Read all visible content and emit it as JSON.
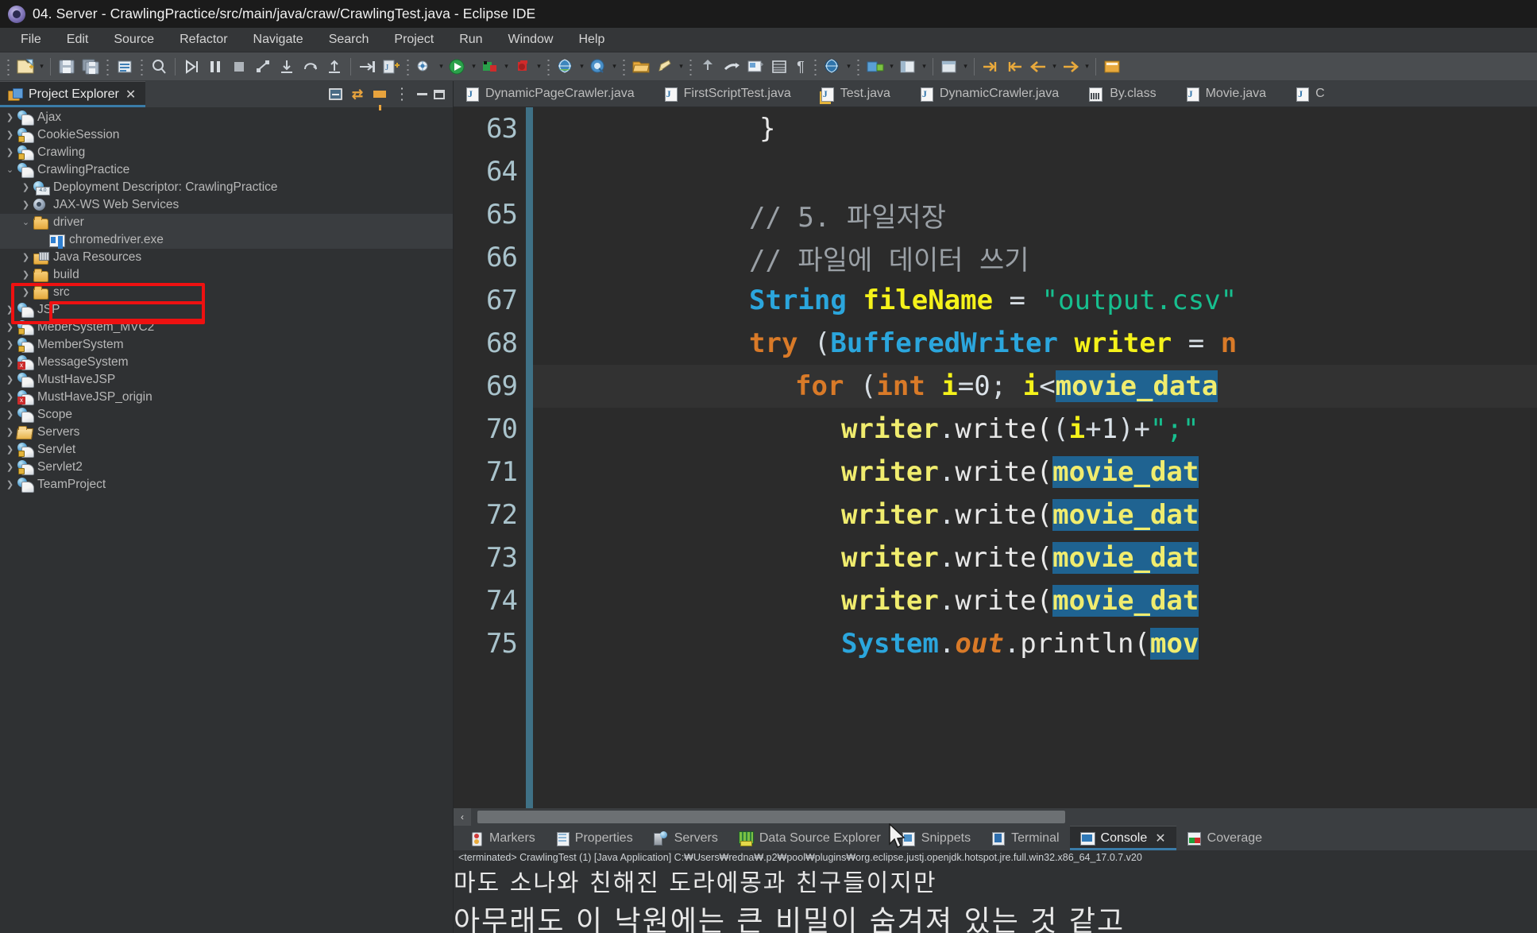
{
  "window": {
    "title": "04. Server - CrawlingPractice/src/main/java/craw/CrawlingTest.java - Eclipse IDE",
    "logo_icon": "eclipse-logo-icon"
  },
  "menubar": {
    "items": [
      "File",
      "Edit",
      "Source",
      "Refactor",
      "Navigate",
      "Search",
      "Project",
      "Run",
      "Window",
      "Help"
    ]
  },
  "toolbar": {
    "icon_names": [
      "new-wizard-icon",
      "save-icon",
      "save-all-icon",
      "print-icon",
      "quick-access-search-icon",
      "run-step-icon",
      "pause-icon",
      "terminate-icon",
      "disconnect-icon",
      "step-into-icon",
      "step-over-icon",
      "step-return-icon",
      "open-type-icon",
      "new-java-class-icon",
      "external-tools-icon",
      "run-icon",
      "debug-icon",
      "coverage-icon",
      "new-server-icon",
      "search-icon",
      "open-folder-icon",
      "edit-icon",
      "git-push-icon",
      "git-pull-icon",
      "image-icon",
      "table-icon",
      "pilcrow-icon",
      "web-browser-icon",
      "profile-icon",
      "perspective-icon",
      "layout-icon",
      "next-annotation-icon",
      "previous-annotation-icon",
      "back-icon",
      "forward-icon",
      "terminal-open-icon"
    ]
  },
  "project_explorer": {
    "tab_label": "Project Explorer",
    "tab_icon": "project-explorer-icon",
    "close_icon": "close-icon",
    "toolbar_icons": [
      "collapse-all-icon",
      "link-with-editor-icon",
      "view-menu-filter-icon",
      "view-menu-icon",
      "minimize-icon",
      "maximize-icon"
    ],
    "tree": [
      {
        "label": "Ajax",
        "indent": 0,
        "twist": "collapsed",
        "icon": "dynamic-web-project-icon"
      },
      {
        "label": "CookieSession",
        "indent": 0,
        "twist": "collapsed",
        "icon": "dynamic-web-project-locked-icon"
      },
      {
        "label": "Crawling",
        "indent": 0,
        "twist": "collapsed",
        "icon": "dynamic-web-project-locked-icon"
      },
      {
        "label": "CrawlingPractice",
        "indent": 0,
        "twist": "expanded",
        "icon": "dynamic-web-project-icon"
      },
      {
        "label": "Deployment Descriptor: CrawlingPractice",
        "indent": 1,
        "twist": "collapsed",
        "icon": "deployment-descriptor-icon"
      },
      {
        "label": "JAX-WS Web Services",
        "indent": 1,
        "twist": "collapsed",
        "icon": "jax-ws-icon"
      },
      {
        "label": "driver",
        "indent": 1,
        "twist": "expanded",
        "icon": "folder-icon",
        "selected": true
      },
      {
        "label": "chromedriver.exe",
        "indent": 2,
        "twist": "none",
        "icon": "executable-file-icon",
        "selected": true
      },
      {
        "label": "Java Resources",
        "indent": 1,
        "twist": "collapsed",
        "icon": "java-resources-icon"
      },
      {
        "label": "build",
        "indent": 1,
        "twist": "collapsed",
        "icon": "folder-icon"
      },
      {
        "label": "src",
        "indent": 1,
        "twist": "collapsed",
        "icon": "folder-icon"
      },
      {
        "label": "JSP",
        "indent": 0,
        "twist": "collapsed",
        "icon": "dynamic-web-project-icon"
      },
      {
        "label": "MeberSystem_MVC2",
        "indent": 0,
        "twist": "collapsed",
        "icon": "dynamic-web-project-locked-icon"
      },
      {
        "label": "MemberSystem",
        "indent": 0,
        "twist": "collapsed",
        "icon": "dynamic-web-project-locked-icon"
      },
      {
        "label": "MessageSystem",
        "indent": 0,
        "twist": "collapsed",
        "icon": "dynamic-web-project-error-icon"
      },
      {
        "label": "MustHaveJSP",
        "indent": 0,
        "twist": "collapsed",
        "icon": "dynamic-web-project-icon"
      },
      {
        "label": "MustHaveJSP_origin",
        "indent": 0,
        "twist": "collapsed",
        "icon": "dynamic-web-project-error-icon"
      },
      {
        "label": "Scope",
        "indent": 0,
        "twist": "collapsed",
        "icon": "dynamic-web-project-icon"
      },
      {
        "label": "Servers",
        "indent": 0,
        "twist": "collapsed",
        "icon": "servers-folder-icon"
      },
      {
        "label": "Servlet",
        "indent": 0,
        "twist": "collapsed",
        "icon": "dynamic-web-project-locked-icon"
      },
      {
        "label": "Servlet2",
        "indent": 0,
        "twist": "collapsed",
        "icon": "dynamic-web-project-locked-icon"
      },
      {
        "label": "TeamProject",
        "indent": 0,
        "twist": "collapsed",
        "icon": "dynamic-web-project-icon"
      }
    ],
    "annotation_color": "#ee1111"
  },
  "editor": {
    "tabs": [
      {
        "label": "DynamicPageCrawler.java",
        "icon": "java-file-icon"
      },
      {
        "label": "FirstScriptTest.java",
        "icon": "java-file-icon"
      },
      {
        "label": "Test.java",
        "icon": "java-file-warning-icon"
      },
      {
        "label": "DynamicCrawler.java",
        "icon": "java-file-icon"
      },
      {
        "label": "By.class",
        "icon": "class-file-icon"
      },
      {
        "label": "Movie.java",
        "icon": "java-file-icon"
      },
      {
        "label": "C",
        "icon": "java-file-icon"
      }
    ],
    "line_numbers": [
      "63",
      "64",
      "65",
      "66",
      "67",
      "68",
      "69",
      "70",
      "71",
      "72",
      "73",
      "74",
      "75"
    ],
    "current_line": "69",
    "scrollbar": {
      "left_arrow_icon": "chevron-left-icon"
    },
    "lines": [
      {
        "num": "63",
        "text": "\t\t}"
      },
      {
        "num": "64",
        "text": ""
      },
      {
        "num": "65",
        "text": "\t\t// 5. 파일저장"
      },
      {
        "num": "66",
        "text": "\t\t// 파일에 데이터 쓰기"
      },
      {
        "num": "67",
        "text": "\t\tString fileName = \"output.csv\""
      },
      {
        "num": "68",
        "text": "\t\ttry (BufferedWriter writer = n"
      },
      {
        "num": "69",
        "text": "\t\t\tfor (int i=0; i<movie_data"
      },
      {
        "num": "70",
        "text": "\t\t\t\twriter.write((i+1)+\";\""
      },
      {
        "num": "71",
        "text": "\t\t\t\twriter.write(movie_dat"
      },
      {
        "num": "72",
        "text": "\t\t\t\twriter.write(movie_dat"
      },
      {
        "num": "73",
        "text": "\t\t\t\twriter.write(movie_dat"
      },
      {
        "num": "74",
        "text": "\t\t\t\twriter.write(movie_dat"
      },
      {
        "num": "75",
        "text": "\t\t\t\tSystem.out.println(mov"
      }
    ]
  },
  "bottom_panel": {
    "tabs": [
      {
        "label": "Markers",
        "icon": "markers-icon",
        "active": false
      },
      {
        "label": "Properties",
        "icon": "properties-icon",
        "active": false
      },
      {
        "label": "Servers",
        "icon": "servers-view-icon",
        "active": false
      },
      {
        "label": "Data Source Explorer",
        "icon": "data-source-explorer-icon",
        "active": false
      },
      {
        "label": "Snippets",
        "icon": "snippets-icon",
        "active": false
      },
      {
        "label": "Terminal",
        "icon": "terminal-icon",
        "active": false
      },
      {
        "label": "Console",
        "icon": "console-icon",
        "active": true
      },
      {
        "label": "Coverage",
        "icon": "coverage-icon",
        "active": false
      }
    ],
    "close_icon": "close-icon",
    "console": {
      "status_line": "<terminated> CrawlingTest (1) [Java Application] C:₩Users₩redna₩.p2₩pool₩plugins₩org.eclipse.justj.openjdk.hotspot.jre.full.win32.x86_64_17.0.7.v20",
      "output_lines": [
        "마도 소나와  친해진  도라에몽과  친구들이지만",
        "아무래도  이  낙원에는  큰  비밀이  숨겨져  있는  것  같고"
      ]
    }
  },
  "cursor": {
    "icon": "mouse-pointer-icon"
  }
}
